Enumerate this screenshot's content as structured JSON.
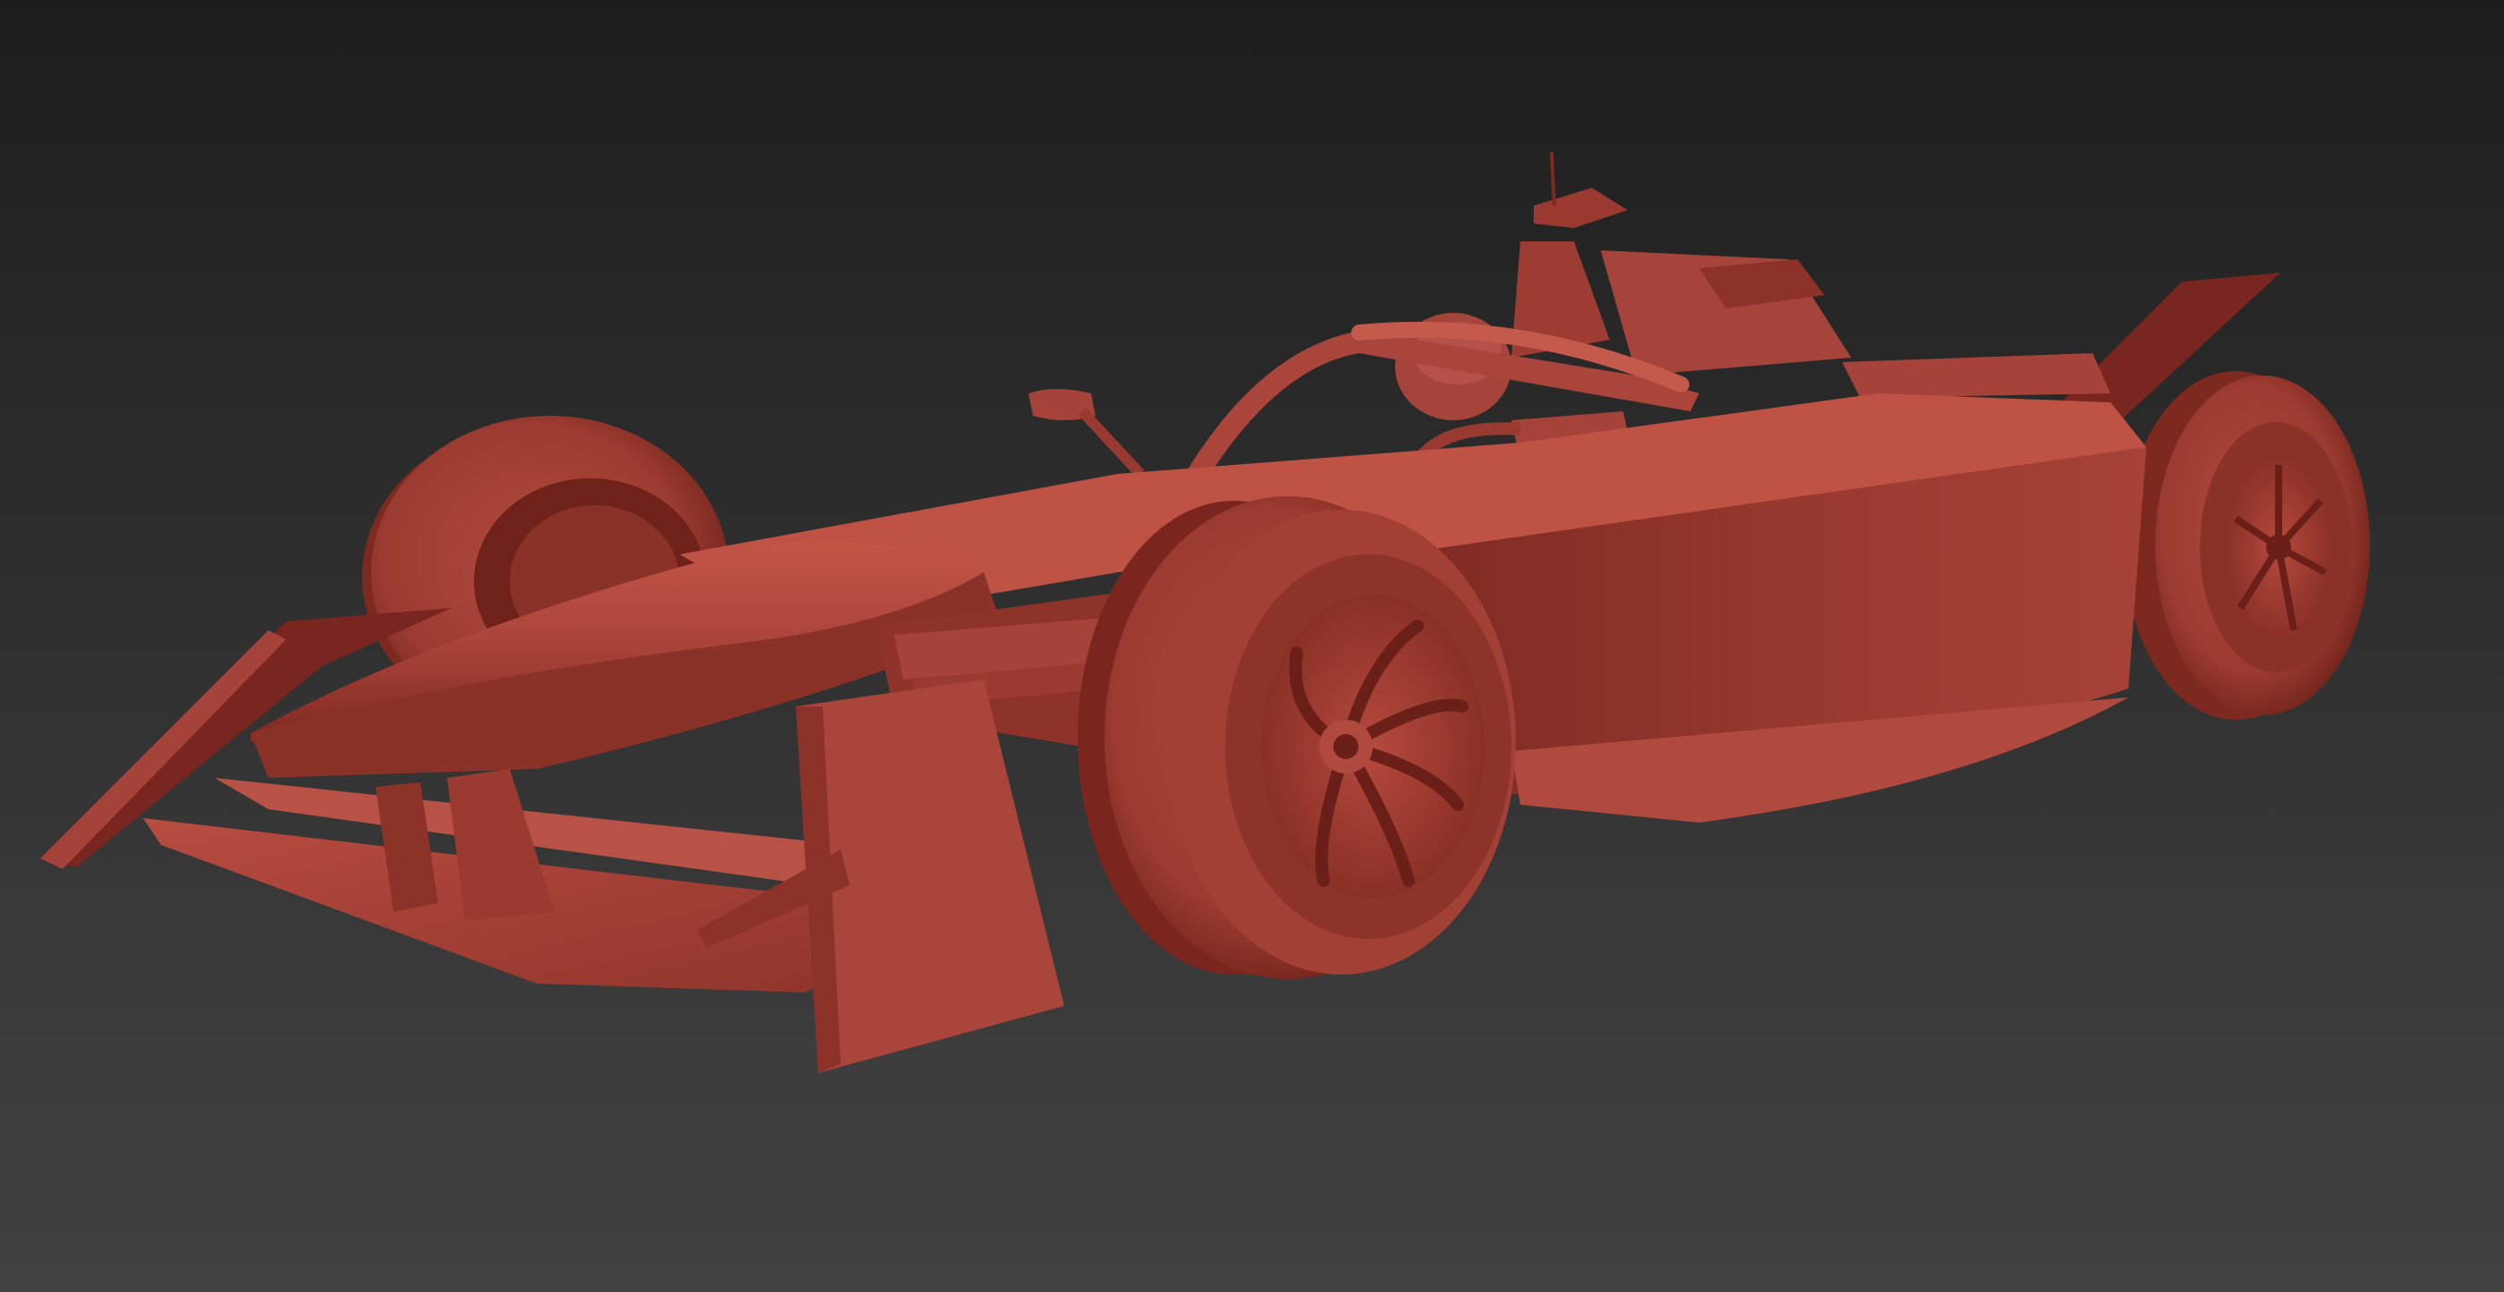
{
  "viewport": {
    "background_top": "#1d1d1d",
    "background_bottom": "#424242"
  },
  "model": {
    "subject": "race-car",
    "material_color": "#b8483c",
    "shadow_color": "#6e1f18",
    "highlight_color": "#c95a4c"
  }
}
